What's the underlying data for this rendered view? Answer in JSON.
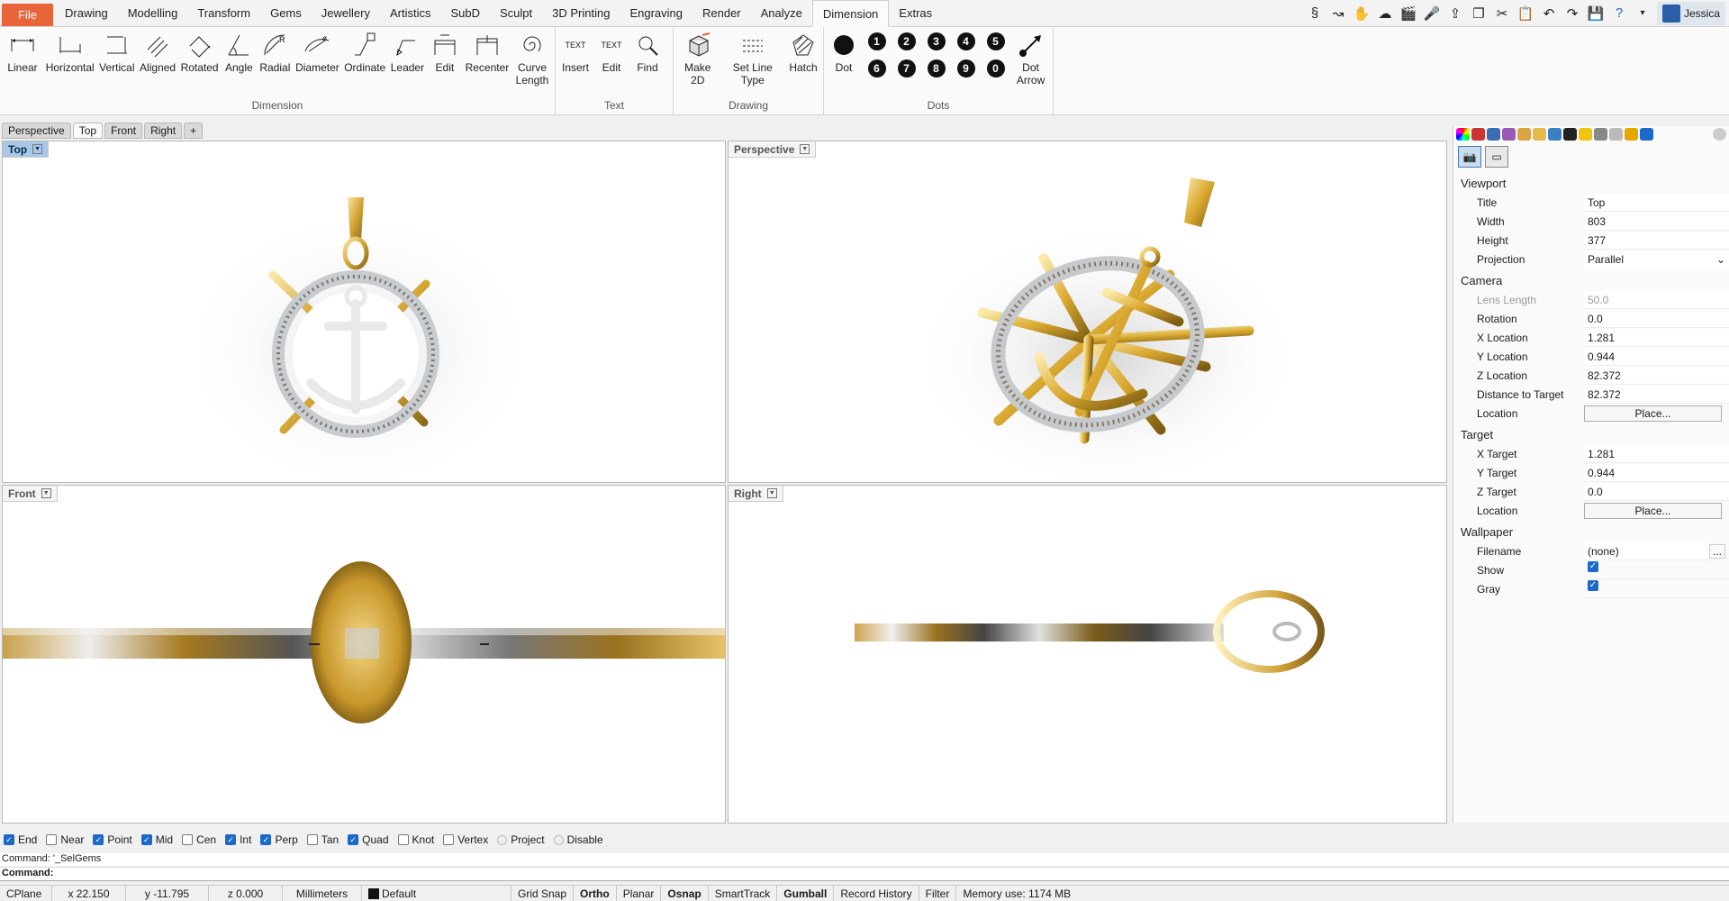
{
  "menu": {
    "file": "File",
    "tabs": [
      "Drawing",
      "Modelling",
      "Transform",
      "Gems",
      "Jewellery",
      "Artistics",
      "SubD",
      "Sculpt",
      "3D Printing",
      "Engraving",
      "Render",
      "Analyze",
      "Dimension",
      "Extras"
    ],
    "active_tab": "Dimension",
    "user": "Jessica"
  },
  "ribbon": {
    "dimension": {
      "name": "Dimension",
      "buttons": [
        "Linear",
        "Horizontal",
        "Vertical",
        "Aligned",
        "Rotated",
        "Angle",
        "Radial",
        "Diameter",
        "Ordinate",
        "Leader",
        "Edit",
        "Recenter",
        "Curve Length"
      ]
    },
    "text": {
      "name": "Text",
      "buttons": [
        "Insert",
        "Edit",
        "Find"
      ],
      "icon_text": "TEXT"
    },
    "drawing": {
      "name": "Drawing",
      "buttons": [
        "Make 2D",
        "Set Line Type",
        "Hatch"
      ]
    },
    "dots": {
      "name": "Dots",
      "dot_label": "Dot",
      "numbers": [
        "1",
        "2",
        "3",
        "4",
        "5",
        "6",
        "7",
        "8",
        "9",
        "0"
      ],
      "arrow_label": "Dot Arrow"
    }
  },
  "viewport_tabs": [
    "Perspective",
    "Top",
    "Front",
    "Right"
  ],
  "active_viewport_tab": "Top",
  "viewports": {
    "top": "Top",
    "perspective": "Perspective",
    "front": "Front",
    "right": "Right"
  },
  "properties": {
    "viewport": {
      "section": "Viewport",
      "rows": [
        {
          "k": "Title",
          "v": "Top"
        },
        {
          "k": "Width",
          "v": "803"
        },
        {
          "k": "Height",
          "v": "377"
        }
      ],
      "projection_label": "Projection",
      "projection_value": "Parallel"
    },
    "camera": {
      "section": "Camera",
      "lens_label": "Lens Length",
      "lens_value": "50.0",
      "rows": [
        {
          "k": "Rotation",
          "v": "0.0"
        },
        {
          "k": "X Location",
          "v": "1.281"
        },
        {
          "k": "Y Location",
          "v": "0.944"
        },
        {
          "k": "Z Location",
          "v": "82.372"
        },
        {
          "k": "Distance to Target",
          "v": "82.372"
        }
      ],
      "location_label": "Location",
      "place": "Place..."
    },
    "target": {
      "section": "Target",
      "rows": [
        {
          "k": "X Target",
          "v": "1.281"
        },
        {
          "k": "Y Target",
          "v": "0.944"
        },
        {
          "k": "Z Target",
          "v": "0.0"
        }
      ],
      "location_label": "Location",
      "place": "Place..."
    },
    "wallpaper": {
      "section": "Wallpaper",
      "filename_label": "Filename",
      "filename_value": "(none)",
      "more": "...",
      "show_label": "Show",
      "gray_label": "Gray"
    }
  },
  "osnap": {
    "items": [
      {
        "label": "End",
        "checked": true
      },
      {
        "label": "Near",
        "checked": false
      },
      {
        "label": "Point",
        "checked": true
      },
      {
        "label": "Mid",
        "checked": true
      },
      {
        "label": "Cen",
        "checked": false
      },
      {
        "label": "Int",
        "checked": true
      },
      {
        "label": "Perp",
        "checked": true
      },
      {
        "label": "Tan",
        "checked": false
      },
      {
        "label": "Quad",
        "checked": true
      },
      {
        "label": "Knot",
        "checked": false
      },
      {
        "label": "Vertex",
        "checked": false
      }
    ],
    "project": "Project",
    "disable": "Disable"
  },
  "command": {
    "history": "Command: '_SelGems",
    "prompt": "Command:"
  },
  "status": {
    "cplane": "CPlane",
    "x": "x 22.150",
    "y": "y -11.795",
    "z": "z 0.000",
    "units": "Millimeters",
    "layer": "Default",
    "grid_snap": "Grid Snap",
    "ortho": "Ortho",
    "planar": "Planar",
    "osnap": "Osnap",
    "smarttrack": "SmartTrack",
    "gumball": "Gumball",
    "record_history": "Record History",
    "filter": "Filter",
    "memory": "Memory use: 1174 MB"
  },
  "colors": {
    "accent": "#e8653a",
    "gold": "#d4a534",
    "silver": "#cfd3d6",
    "active_blue": "#a9c8e8"
  }
}
